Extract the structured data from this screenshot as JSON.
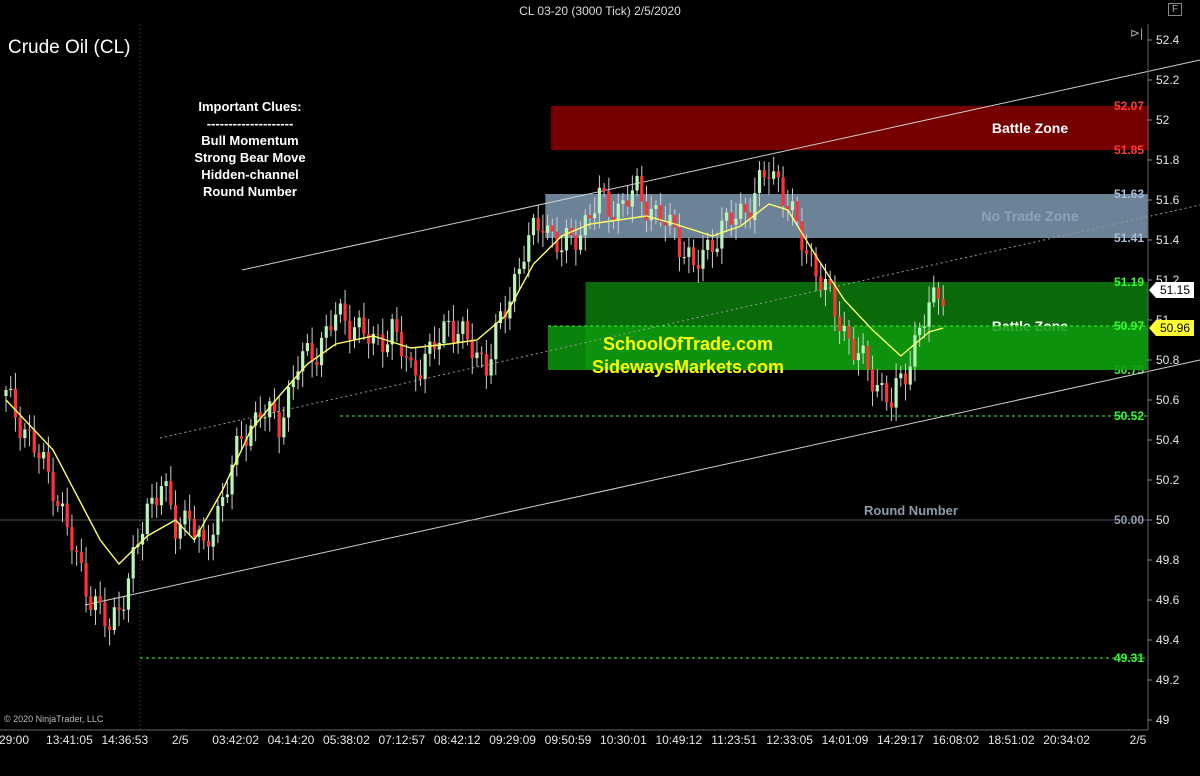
{
  "window": {
    "title": "CL 03-20 (3000 Tick)  2/5/2020",
    "copyright": "© 2020 NinjaTrader, LLC"
  },
  "icons": {
    "panel_toggle": "skip-forward-icon",
    "format": "format-icon"
  },
  "chart_data": {
    "type": "candlestick",
    "title": "Crude Oil (CL)",
    "y_ticks": [
      52.4,
      52.2,
      52.0,
      51.8,
      51.6,
      51.4,
      51.2,
      51.0,
      50.8,
      50.6,
      50.4,
      50.2,
      50.0,
      49.8,
      49.6,
      49.4,
      49.2,
      49.0
    ],
    "x_tick_labels": [
      "29:00",
      "13:41:05",
      "14:36:53",
      "2/5",
      "03:42:02",
      "04:14:20",
      "05:38:02",
      "07:12:57",
      "08:42:12",
      "09:29:09",
      "09:50:59",
      "10:30:01",
      "10:49:12",
      "11:23:51",
      "12:33:05",
      "14:01:09",
      "14:29:17",
      "16:08:02",
      "18:51:02",
      "20:34:02",
      "2/5"
    ],
    "close_path": [
      [
        0,
        50.62
      ],
      [
        4,
        50.45
      ],
      [
        10,
        50.18
      ],
      [
        15,
        49.8
      ],
      [
        18,
        49.62
      ],
      [
        22,
        49.45
      ],
      [
        26,
        49.7
      ],
      [
        30,
        50.05
      ],
      [
        33,
        50.2
      ],
      [
        36,
        49.95
      ],
      [
        39,
        50.05
      ],
      [
        42,
        49.82
      ],
      [
        46,
        50.12
      ],
      [
        50,
        50.4
      ],
      [
        54,
        50.55
      ],
      [
        58,
        50.48
      ],
      [
        62,
        50.78
      ],
      [
        66,
        50.85
      ],
      [
        70,
        51.02
      ],
      [
        74,
        50.98
      ],
      [
        78,
        50.88
      ],
      [
        82,
        50.95
      ],
      [
        86,
        50.75
      ],
      [
        90,
        50.82
      ],
      [
        94,
        51.0
      ],
      [
        98,
        50.88
      ],
      [
        102,
        50.78
      ],
      [
        106,
        51.05
      ],
      [
        110,
        51.35
      ],
      [
        114,
        51.5
      ],
      [
        118,
        51.35
      ],
      [
        122,
        51.45
      ],
      [
        126,
        51.6
      ],
      [
        130,
        51.55
      ],
      [
        134,
        51.65
      ],
      [
        138,
        51.52
      ],
      [
        142,
        51.45
      ],
      [
        146,
        51.25
      ],
      [
        150,
        51.4
      ],
      [
        154,
        51.5
      ],
      [
        158,
        51.58
      ],
      [
        162,
        51.75
      ],
      [
        164,
        51.7
      ],
      [
        168,
        51.45
      ],
      [
        172,
        51.25
      ],
      [
        176,
        51.05
      ],
      [
        180,
        50.85
      ],
      [
        184,
        50.72
      ],
      [
        188,
        50.58
      ],
      [
        191,
        50.75
      ],
      [
        194,
        50.95
      ],
      [
        198,
        51.15
      ]
    ],
    "ma_path": [
      [
        0,
        50.6
      ],
      [
        10,
        50.35
      ],
      [
        20,
        49.9
      ],
      [
        24,
        49.78
      ],
      [
        30,
        49.92
      ],
      [
        36,
        50.0
      ],
      [
        40,
        49.9
      ],
      [
        46,
        50.15
      ],
      [
        52,
        50.45
      ],
      [
        58,
        50.62
      ],
      [
        64,
        50.78
      ],
      [
        70,
        50.88
      ],
      [
        78,
        50.92
      ],
      [
        86,
        50.86
      ],
      [
        94,
        50.88
      ],
      [
        100,
        50.9
      ],
      [
        106,
        51.02
      ],
      [
        112,
        51.28
      ],
      [
        118,
        51.42
      ],
      [
        124,
        51.48
      ],
      [
        130,
        51.5
      ],
      [
        136,
        51.52
      ],
      [
        142,
        51.48
      ],
      [
        150,
        51.42
      ],
      [
        156,
        51.47
      ],
      [
        162,
        51.58
      ],
      [
        166,
        51.55
      ],
      [
        172,
        51.32
      ],
      [
        178,
        51.1
      ],
      [
        184,
        50.95
      ],
      [
        190,
        50.82
      ],
      [
        196,
        50.94
      ],
      [
        199,
        50.96
      ]
    ],
    "candle_count": 200,
    "y_range": [
      48.95,
      52.48
    ],
    "zones": [
      {
        "label": "Battle Zone",
        "top": 52.07,
        "bottom": 51.85,
        "color": "#8b0000",
        "top_label_color": "#ff3b3b",
        "bottom_label_color": "#ff3b3b",
        "x_from": 0.48
      },
      {
        "label": "No Trade Zone",
        "top": 51.63,
        "bottom": 51.41,
        "color": "#7f99b2",
        "top_label_color": "#a9bfd6",
        "bottom_label_color": "#a9bfd6",
        "x_from": 0.475
      },
      {
        "label": "Battle Zone",
        "top": 51.19,
        "bottom": 50.75,
        "color": "#0b7d0b",
        "top_label_color": "#33ff33",
        "bottom_label_color": "#33ff33",
        "x_from": 0.51
      }
    ],
    "levels": [
      {
        "label": "50.97",
        "value": 50.97,
        "color": "#33ff33"
      },
      {
        "label": "50.52",
        "value": 50.52,
        "color": "#33ff33"
      },
      {
        "label": "50.00",
        "value": 50.0,
        "color": "#8f9bab"
      },
      {
        "label": "49.31",
        "value": 49.31,
        "color": "#33ff33"
      }
    ],
    "annotations": {
      "clues": [
        "Important Clues:",
        "--------------------",
        "Bull Momentum",
        "Strong Bear Move",
        "Hidden-channel",
        "Round Number"
      ],
      "site1": "SchoolOfTrade.com",
      "site2": "SidewaysMarkets.com",
      "round_number": "Round Number"
    },
    "price_markers": [
      {
        "label": "51.15",
        "value": 51.15,
        "bg": "#ffffff",
        "fg": "#000000"
      },
      {
        "label": "50.96",
        "value": 50.96,
        "bg": "#ffff33",
        "fg": "#000000"
      }
    ],
    "ma_color": "#ffff66",
    "up_color": "#b8f5b8",
    "down_color": "#ff3333"
  }
}
